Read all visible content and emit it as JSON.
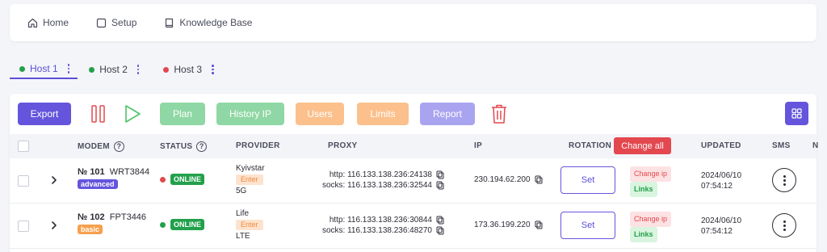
{
  "nav": [
    {
      "label": "Home",
      "icon": "home-icon"
    },
    {
      "label": "Setup",
      "icon": "square-icon"
    },
    {
      "label": "Knowledge Base",
      "icon": "book-icon"
    }
  ],
  "hosts": [
    {
      "label": "Host 1",
      "color": "#22a04b",
      "active": true
    },
    {
      "label": "Host 2",
      "color": "#22a04b",
      "active": false
    },
    {
      "label": "Host 3",
      "color": "#e3484f",
      "active": false
    }
  ],
  "toolbar": {
    "export": "Export",
    "plan": "Plan",
    "history_ip": "History IP",
    "users": "Users",
    "limits": "Limits",
    "report": "Report"
  },
  "columns": {
    "modem": "MODEM",
    "status": "STATUS",
    "provider": "PROVIDER",
    "proxy": "PROXY",
    "ip": "IP",
    "rotation": "ROTATION",
    "change_all": "Change all",
    "updated": "UPDATED",
    "sms": "SMS",
    "more": "N"
  },
  "rows": [
    {
      "num": "№ 101",
      "code": "WRT3844",
      "tag": "advanced",
      "tag_color": "#6555dc",
      "status": "ONLINE",
      "provider": "Kyivstar",
      "enter": "Enter",
      "network": "5G",
      "http": "http: 116.133.138.236:24138",
      "socks": "socks: 116.133.138.236:32544",
      "ip": "230.194.62.200",
      "set": "Set",
      "change_ip": "Change ip",
      "links": "Links",
      "date": "2024/06/10",
      "time": "07:54:12"
    },
    {
      "num": "№ 102",
      "code": "FPT3446",
      "tag": "basic",
      "tag_color": "#f6a04d",
      "status": "ONLINE",
      "provider": "Life",
      "enter": "Enter",
      "network": "LTE",
      "http": "http: 116.133.138.236:30844",
      "socks": "socks: 116.133.138.236:48270",
      "ip": "173.36.199.220",
      "set": "Set",
      "change_ip": "Change ip",
      "links": "Links",
      "date": "2024/06/10",
      "time": "07:54:12"
    }
  ],
  "colors": {
    "accent": "#6555dc",
    "green": "#22a04b",
    "red": "#e3484f",
    "orange": "#fbc08c"
  }
}
